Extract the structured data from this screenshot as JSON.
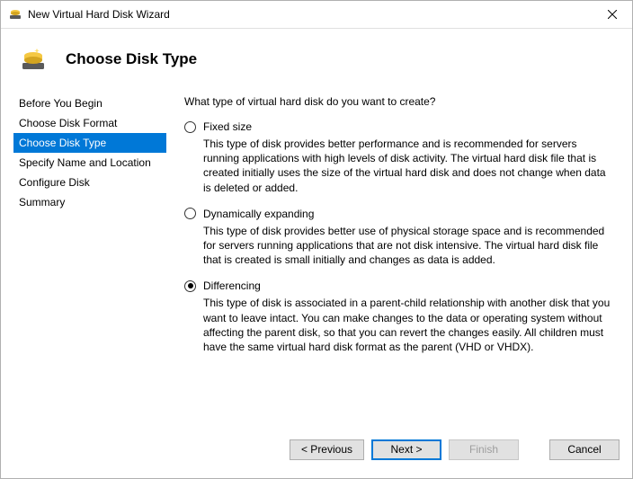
{
  "window": {
    "title": "New Virtual Hard Disk Wizard"
  },
  "header": {
    "title": "Choose Disk Type"
  },
  "sidebar": {
    "items": [
      {
        "label": "Before You Begin"
      },
      {
        "label": "Choose Disk Format"
      },
      {
        "label": "Choose Disk Type"
      },
      {
        "label": "Specify Name and Location"
      },
      {
        "label": "Configure Disk"
      },
      {
        "label": "Summary"
      }
    ],
    "selected_index": 2
  },
  "content": {
    "question": "What type of virtual hard disk do you want to create?",
    "options": [
      {
        "value": "fixed",
        "label": "Fixed size",
        "description": "This type of disk provides better performance and is recommended for servers running applications with high levels of disk activity. The virtual hard disk file that is created initially uses the size of the virtual hard disk and does not change when data is deleted or added."
      },
      {
        "value": "dynamic",
        "label": "Dynamically expanding",
        "description": "This type of disk provides better use of physical storage space and is recommended for servers running applications that are not disk intensive. The virtual hard disk file that is created is small initially and changes as data is added."
      },
      {
        "value": "differencing",
        "label": "Differencing",
        "description": "This type of disk is associated in a parent-child relationship with another disk that you want to leave intact. You can make changes to the data or operating system without affecting the parent disk, so that you can revert the changes easily. All children must have the same virtual hard disk format as the parent (VHD or VHDX)."
      }
    ],
    "selected_option": "differencing"
  },
  "footer": {
    "previous": "< Previous",
    "next": "Next >",
    "finish": "Finish",
    "cancel": "Cancel"
  }
}
